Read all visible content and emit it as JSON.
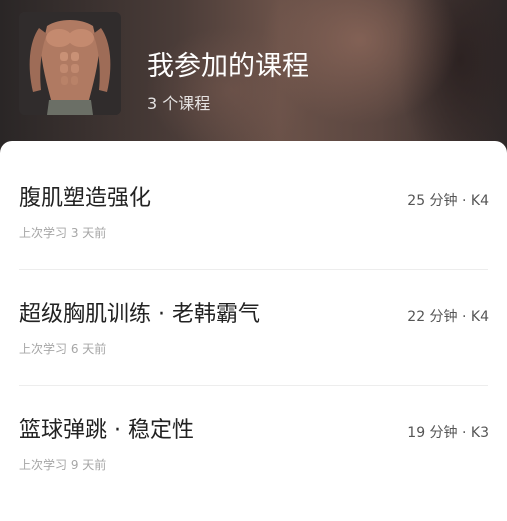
{
  "header": {
    "title": "我参加的课程",
    "count_text": "3 个课程"
  },
  "courses": [
    {
      "name": "腹肌塑造强化",
      "meta": "25 分钟 · K4",
      "last_studied": "上次学习 3 天前"
    },
    {
      "name": "超级胸肌训练 · 老韩霸气",
      "meta": "22 分钟 · K4",
      "last_studied": "上次学习 6 天前"
    },
    {
      "name": "篮球弹跳 · 稳定性",
      "meta": "19 分钟 · K3",
      "last_studied": "上次学习 9 天前"
    }
  ],
  "colors": {
    "title_text": "#ffffff",
    "course_name": "#222222",
    "meta_text": "#555555",
    "secondary_text": "#a6a6a6",
    "divider": "#ededed"
  }
}
